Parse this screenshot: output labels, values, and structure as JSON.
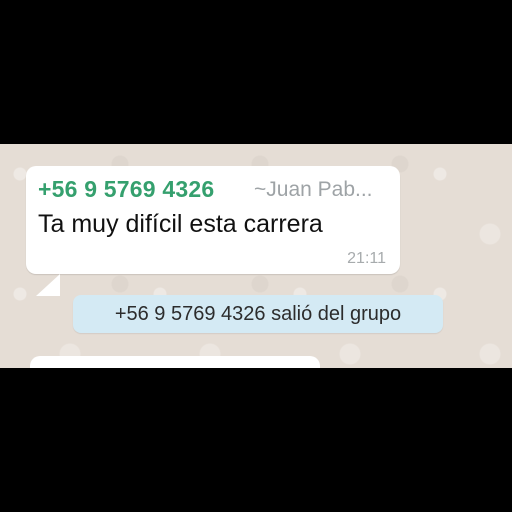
{
  "message": {
    "sender_number": "+56 9 5769 4326",
    "sender_name": "~Juan Pab...",
    "text": "Ta muy difícil esta carrera",
    "time": "21:11"
  },
  "system_note": {
    "text": "+56 9 5769 4326 salió del grupo"
  },
  "colors": {
    "chat_background": "#e5ddd5",
    "incoming_bubble": "#ffffff",
    "sender_number": "#35a06e",
    "system_note_background": "#d4eaf4"
  }
}
